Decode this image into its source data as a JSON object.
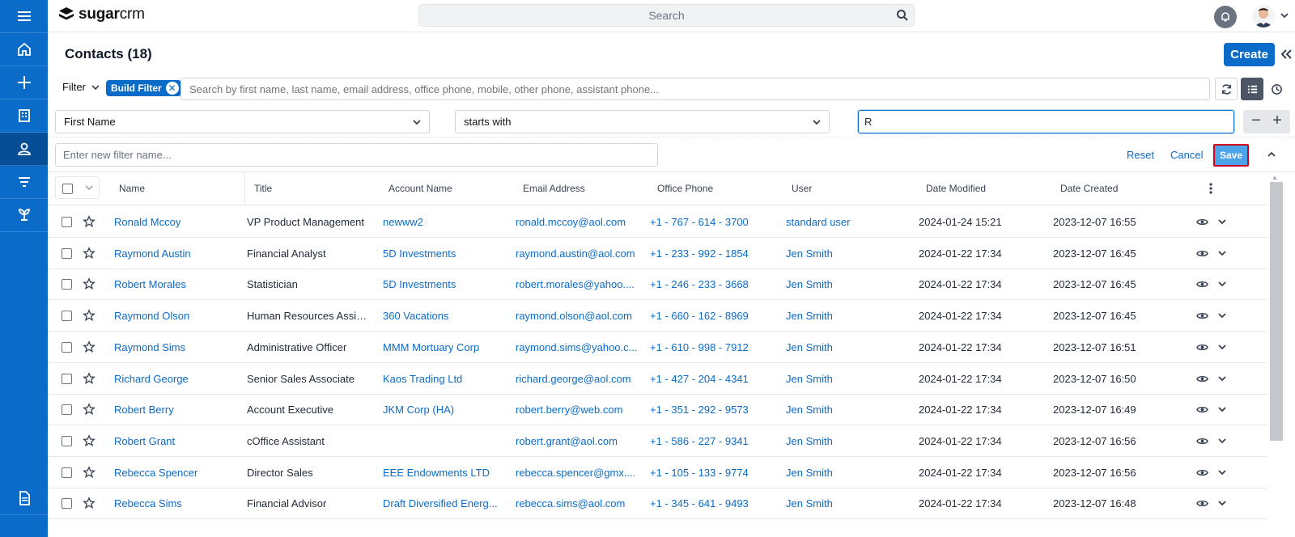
{
  "app": {
    "logo_text_bold": "sugar",
    "logo_text": "crm"
  },
  "search": {
    "placeholder": "Search"
  },
  "nav": [
    "menu-icon",
    "home-icon",
    "plus-icon",
    "accounts-icon",
    "contacts-icon",
    "filter-icon",
    "plant-icon",
    "doc-icon"
  ],
  "page": {
    "title": "Contacts (18)",
    "create_label": "Create"
  },
  "filter": {
    "label": "Filter",
    "build_filter_label": "Build Filter",
    "search_placeholder": "Search by first name, last name, email address, office phone, mobile, other phone, assistant phone...",
    "field": "First Name",
    "operator": "starts with",
    "value": "R",
    "name_placeholder": "Enter new filter name...",
    "reset_label": "Reset",
    "cancel_label": "Cancel",
    "save_label": "Save"
  },
  "table": {
    "columns": [
      "Name",
      "Title",
      "Account Name",
      "Email Address",
      "Office Phone",
      "User",
      "Date Modified",
      "Date Created"
    ],
    "rows": [
      {
        "name": "Ronald Mccoy",
        "title": "VP Product Management",
        "account": "newww2",
        "email": "ronald.mccoy@aol.com",
        "phone": "+1 - 767 - 614 - 3700",
        "user": "standard user",
        "modified": "2024-01-24 15:21",
        "created": "2023-12-07 16:55"
      },
      {
        "name": "Raymond Austin",
        "title": "Financial Analyst",
        "account": "5D Investments",
        "email": "raymond.austin@aol.com",
        "phone": "+1 - 233 - 992 - 1854",
        "user": "Jen Smith",
        "modified": "2024-01-22 17:34",
        "created": "2023-12-07 16:45"
      },
      {
        "name": "Robert Morales",
        "title": "Statistician",
        "account": "5D Investments",
        "email": "robert.morales@yahoo....",
        "phone": "+1 - 246 - 233 - 3668",
        "user": "Jen Smith",
        "modified": "2024-01-22 17:34",
        "created": "2023-12-07 16:45"
      },
      {
        "name": "Raymond Olson",
        "title": "Human Resources Assis...",
        "account": "360 Vacations",
        "email": "raymond.olson@aol.com",
        "phone": "+1 - 660 - 162 - 8969",
        "user": "Jen Smith",
        "modified": "2024-01-22 17:34",
        "created": "2023-12-07 16:45"
      },
      {
        "name": "Raymond Sims",
        "title": "Administrative Officer",
        "account": "MMM Mortuary Corp",
        "email": "raymond.sims@yahoo.c...",
        "phone": "+1 - 610 - 998 - 7912",
        "user": "Jen Smith",
        "modified": "2024-01-22 17:34",
        "created": "2023-12-07 16:51"
      },
      {
        "name": "Richard George",
        "title": "Senior Sales Associate",
        "account": "Kaos Trading Ltd",
        "email": "richard.george@aol.com",
        "phone": "+1 - 427 - 204 - 4341",
        "user": "Jen Smith",
        "modified": "2024-01-22 17:34",
        "created": "2023-12-07 16:50"
      },
      {
        "name": "Robert Berry",
        "title": "Account Executive",
        "account": "JKM Corp (HA)",
        "email": "robert.berry@web.com",
        "phone": "+1 - 351 - 292 - 9573",
        "user": "Jen Smith",
        "modified": "2024-01-22 17:34",
        "created": "2023-12-07 16:49"
      },
      {
        "name": "Robert Grant",
        "title": "cOffice Assistant",
        "account": "",
        "email": "robert.grant@aol.com",
        "phone": "+1 - 586 - 227 - 9341",
        "user": "Jen Smith",
        "modified": "2024-01-22 17:34",
        "created": "2023-12-07 16:56"
      },
      {
        "name": "Rebecca Spencer",
        "title": "Director Sales",
        "account": "EEE Endowments LTD",
        "email": "rebecca.spencer@gmx....",
        "phone": "+1 - 105 - 133 - 9774",
        "user": "Jen Smith",
        "modified": "2024-01-22 17:34",
        "created": "2023-12-07 16:56"
      },
      {
        "name": "Rebecca Sims",
        "title": "Financial Advisor",
        "account": "Draft Diversified Energ...",
        "email": "rebecca.sims@aol.com",
        "phone": "+1 - 345 - 641 - 9493",
        "user": "Jen Smith",
        "modified": "2024-01-22 17:34",
        "created": "2023-12-07 16:48"
      }
    ]
  },
  "colors": {
    "brand": "#0b6bc9",
    "save": "#4ba3e8",
    "highlight_border": "#d0021b"
  }
}
